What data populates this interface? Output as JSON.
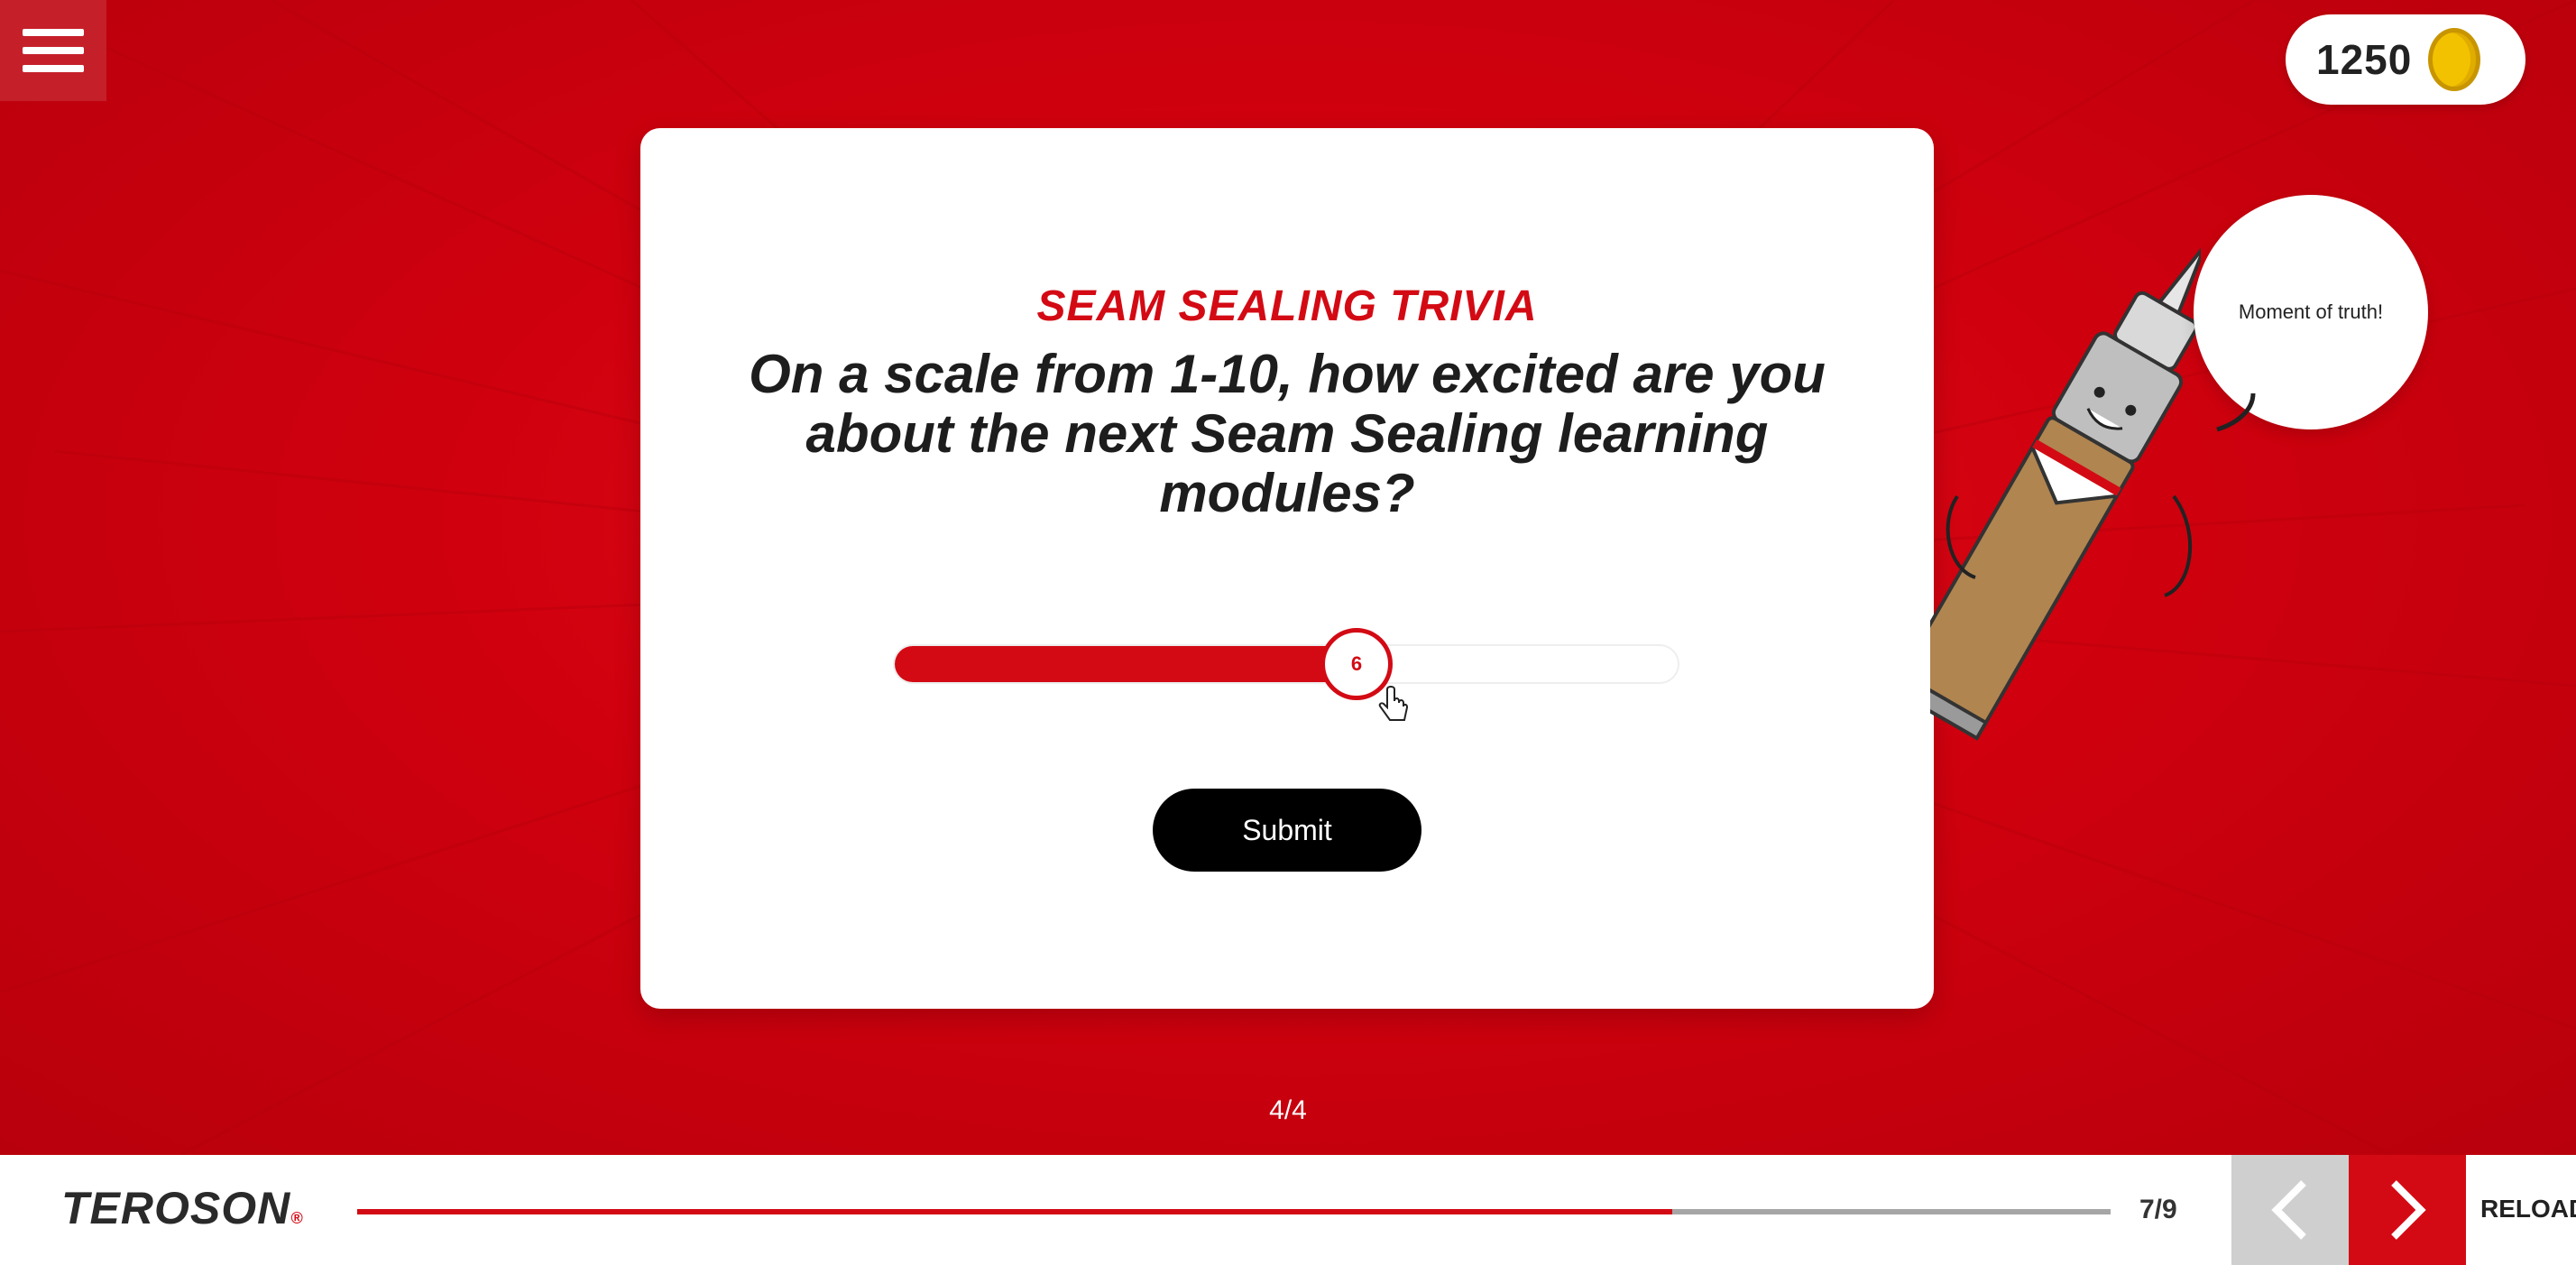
{
  "coins": {
    "count": "1250",
    "icon": "coin-icon"
  },
  "menu": {
    "icon": "hamburger-menu-icon"
  },
  "card": {
    "eyebrow": "SEAM SEALING TRIVIA",
    "question": "On a scale from 1-10, how excited are you about the next Seam Sealing learning modules?",
    "slider": {
      "min": 1,
      "max": 10,
      "value": 6,
      "label": "6",
      "fill_percent": 59
    },
    "submit_label": "Submit"
  },
  "mascot": {
    "speech": "Moment of truth!"
  },
  "step_counter": "4/4",
  "footer": {
    "logo": "TEROSON",
    "logo_mark": "®",
    "progress_percent": 75,
    "page_indicator": "7/9",
    "prev_icon": "chevron-left-icon",
    "next_icon": "chevron-right-icon",
    "reload_label": "RELOAD"
  },
  "colors": {
    "brand_red": "#d30a14",
    "background_red": "#d1000f",
    "progress_track": "#a6a6a6",
    "nav_prev_bg": "#cfcfcf"
  }
}
